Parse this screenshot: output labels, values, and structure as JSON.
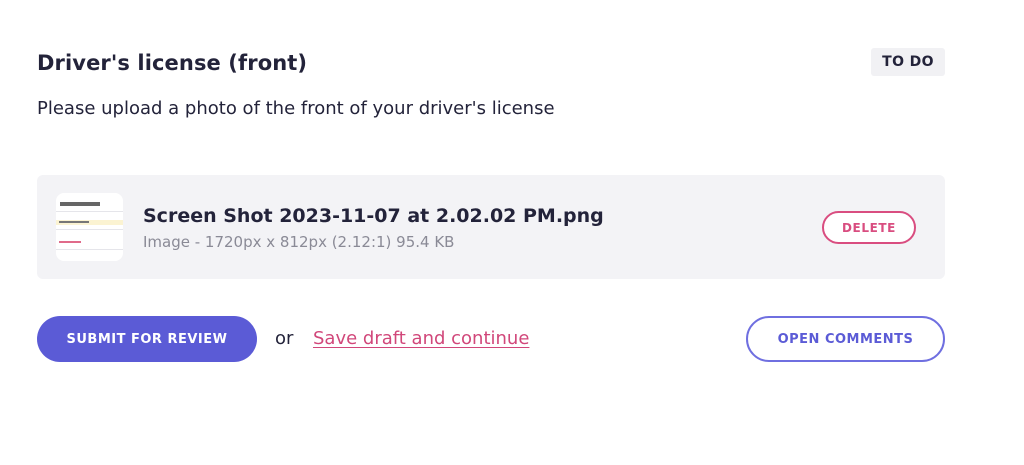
{
  "task": {
    "title": "Driver's license (front)",
    "status": "TO DO",
    "description": "Please upload a photo of the front of your driver's license"
  },
  "file": {
    "name": "Screen Shot 2023-11-07 at 2.02.02 PM.png",
    "meta": "Image - 1720px x 812px (2.12:1) 95.4 KB",
    "thumbnail_icon": "image-thumbnail",
    "delete_label": "DELETE"
  },
  "actions": {
    "submit_label": "SUBMIT FOR REVIEW",
    "or_text": "or",
    "save_draft_label": "Save draft and continue",
    "open_comments_label": "OPEN COMMENTS"
  },
  "colors": {
    "primary": "#5b5bd6",
    "accent_pink": "#d94d80",
    "text": "#23233a",
    "muted": "#8a8a96",
    "file_box_bg": "#f3f3f6"
  }
}
